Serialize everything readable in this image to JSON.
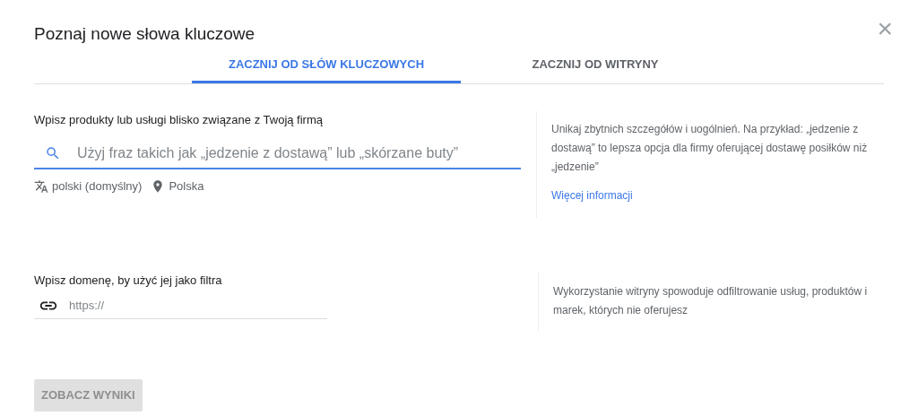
{
  "dialog": {
    "title": "Poznaj nowe słowa kluczowe",
    "close": "×"
  },
  "tabs": [
    {
      "label": "ZACZNIJ OD SŁÓW KLUCZOWYCH",
      "selected": true
    },
    {
      "label": "ZACZNIJ OD WITRYNY",
      "selected": false
    }
  ],
  "keywords": {
    "label": "Wpisz produkty lub usługi blisko związane z Twoją firmą",
    "placeholder": "Użyj fraz takich jak „jedzenie z dostawą” lub „skórzane buty”",
    "language": "polski (domyślny)",
    "location": "Polska",
    "hint": "Unikaj zbytnich szczegółów i uogólnień. Na przykład: „jedzenie z dostawą” to lepsza opcja dla firmy oferującej dostawę posiłków niż „jedzenie”",
    "link": "Więcej informacji"
  },
  "domain": {
    "label": "Wpisz domenę, by użyć jej jako filtra",
    "placeholder": "https://",
    "hint": "Wykorzystanie witryny spowoduje odfiltrowanie usług, produktów i marek, których nie oferujesz"
  },
  "submit": {
    "label": "ZOBACZ WYNIKI",
    "disabled": true
  }
}
